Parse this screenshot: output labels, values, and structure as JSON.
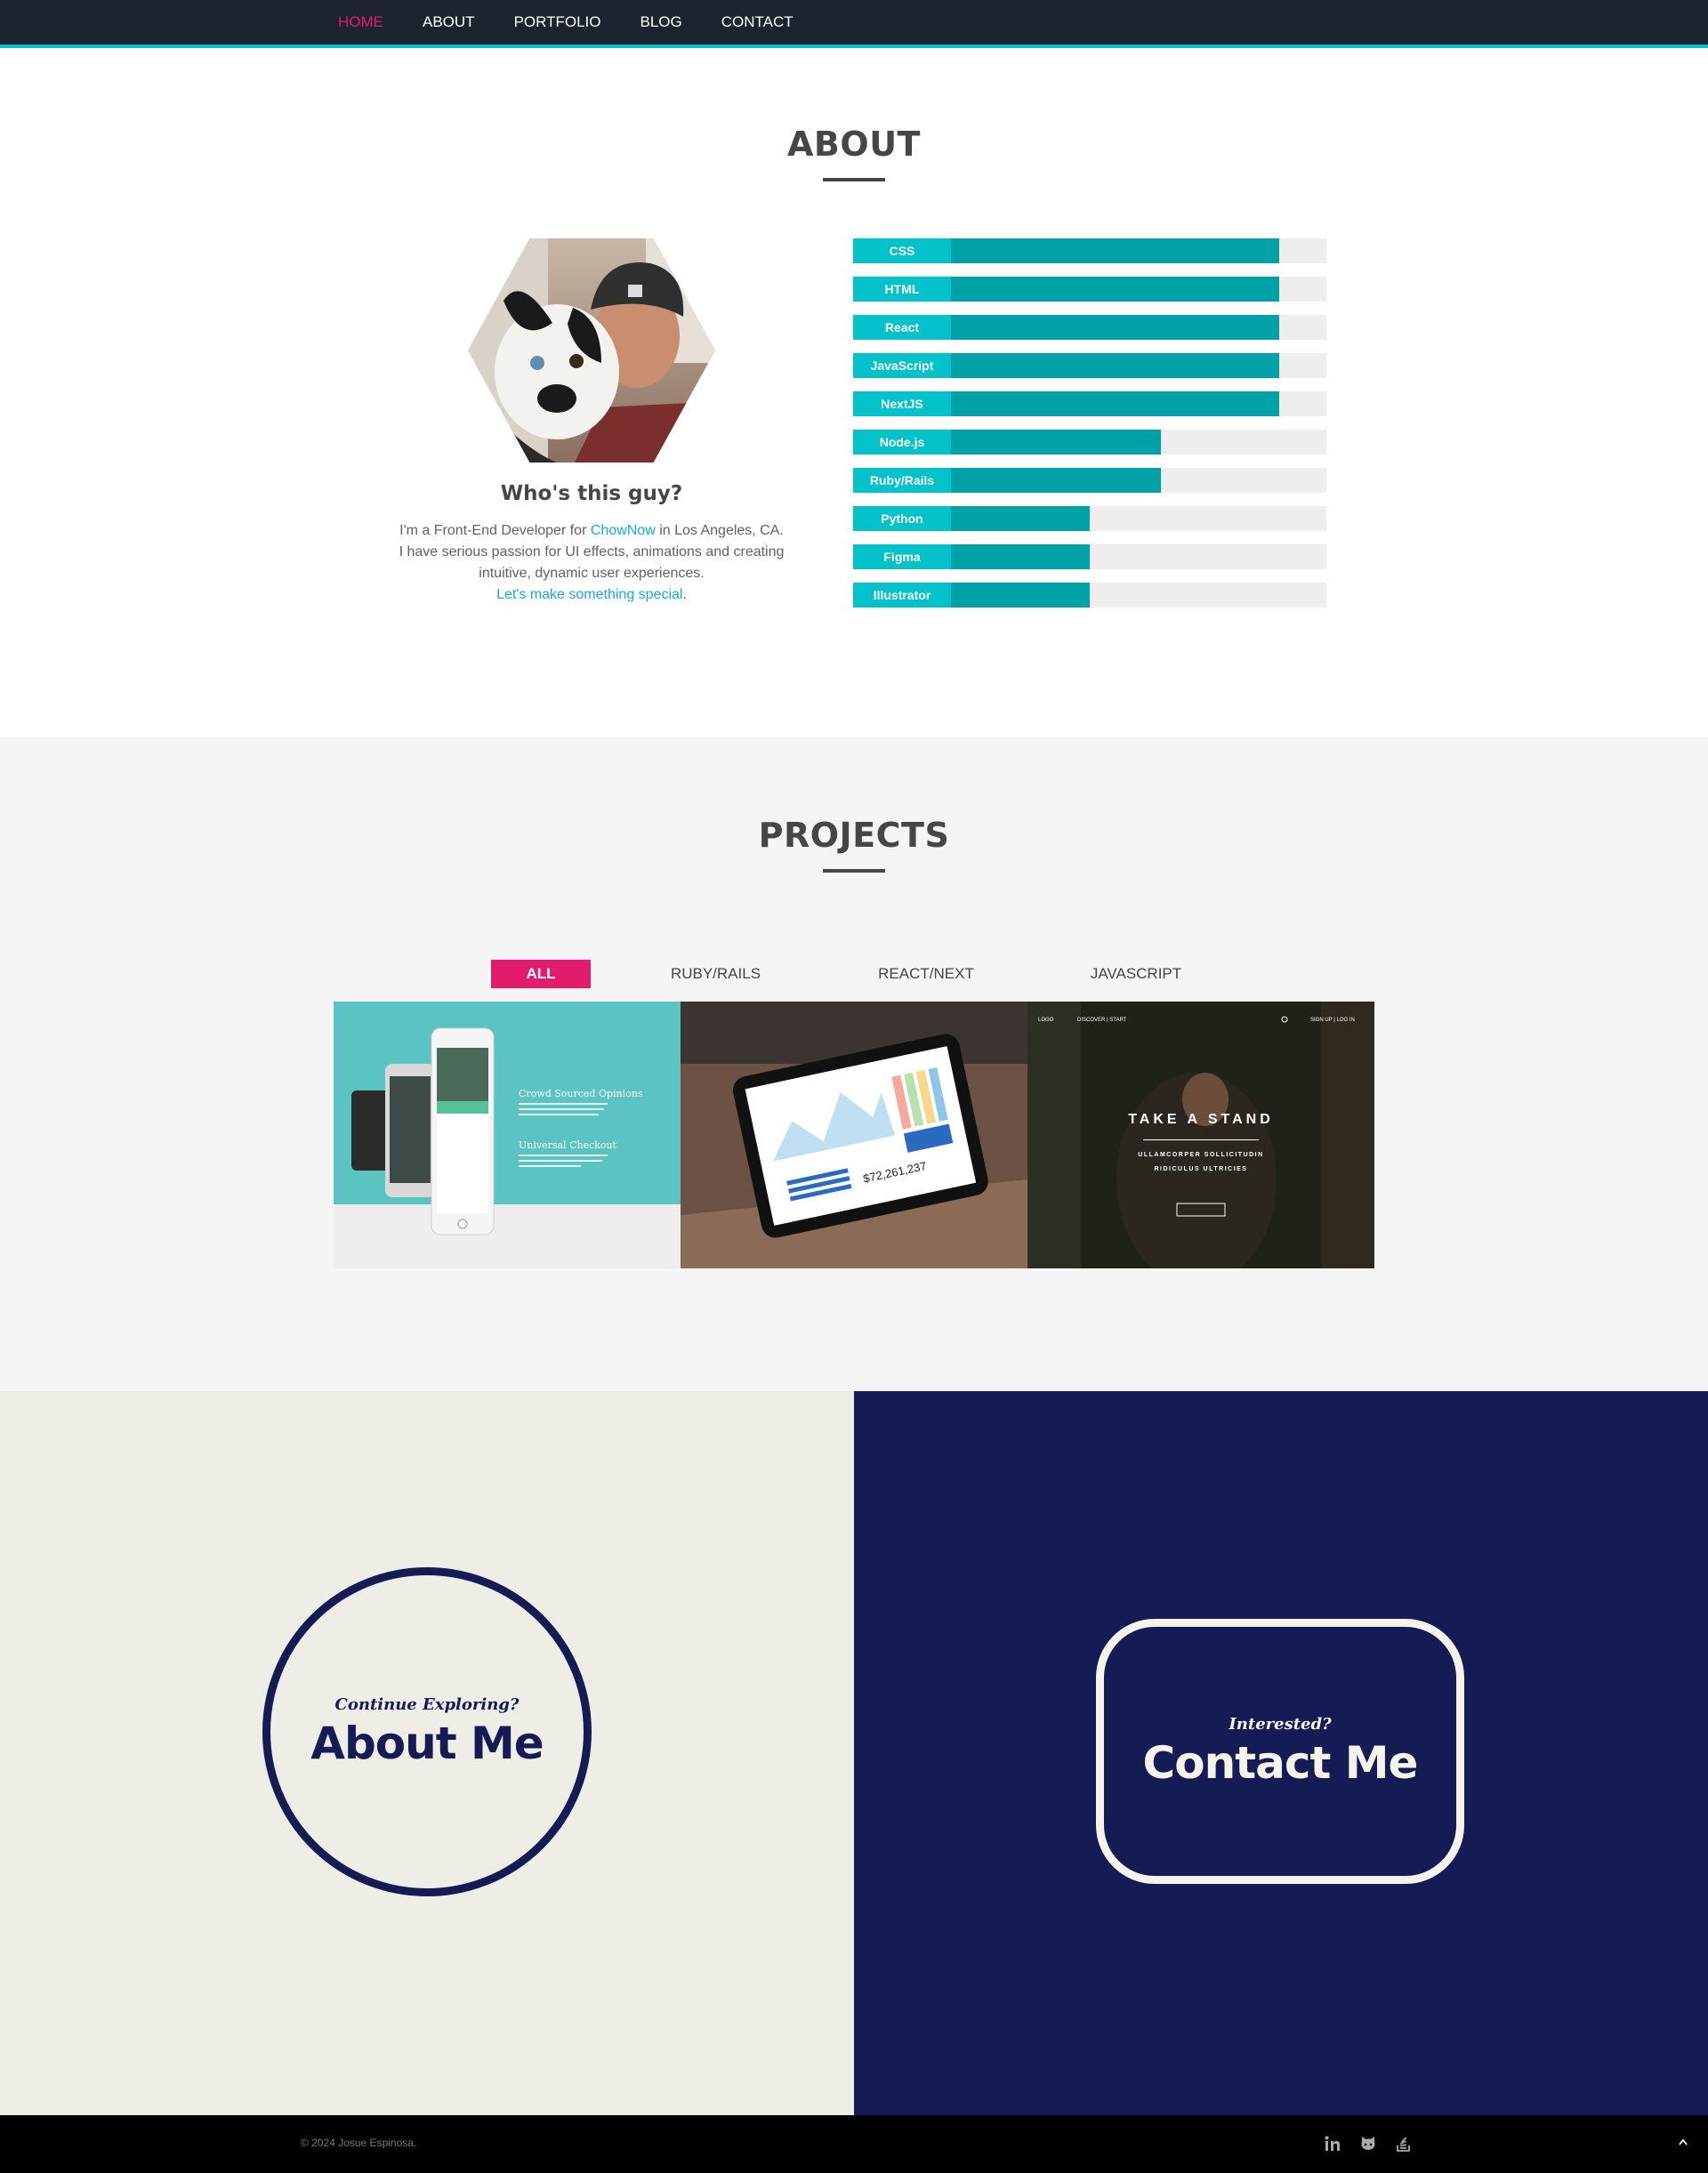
{
  "nav": {
    "items": [
      "HOME",
      "ABOUT",
      "PORTFOLIO",
      "BLOG",
      "CONTACT"
    ],
    "active_index": 0
  },
  "about": {
    "title": "ABOUT",
    "who_title": "Who's this guy?",
    "bio": {
      "part1": "I'm a Front-End Developer for ",
      "company_link": "ChowNow",
      "part2": " in Los Angeles, CA.",
      "line2": "I have serious passion for UI effects, animations and creating",
      "line3": "intuitive, dynamic user experiences.",
      "cta_link": "Let's make something special",
      "cta_end": "."
    },
    "skills": [
      {
        "name": "CSS",
        "level": 0.9
      },
      {
        "name": "HTML",
        "level": 0.9
      },
      {
        "name": "React",
        "level": 0.9
      },
      {
        "name": "JavaScript",
        "level": 0.9
      },
      {
        "name": "NextJS",
        "level": 0.9
      },
      {
        "name": "Node.js",
        "level": 0.65
      },
      {
        "name": "Ruby/Rails",
        "level": 0.65
      },
      {
        "name": "Python",
        "level": 0.5
      },
      {
        "name": "Figma",
        "level": 0.5
      },
      {
        "name": "Illustrator",
        "level": 0.5
      }
    ]
  },
  "projects": {
    "title": "PROJECTS",
    "filters": [
      "ALL",
      "RUBY/RAILS",
      "REACT/NEXT",
      "JAVASCRIPT"
    ],
    "active_filter": 0,
    "cards": [
      {
        "heading1": "Crowd Sourced Opinions",
        "heading2": "Universal Checkout"
      },
      {
        "amount": "$72,261,237"
      },
      {
        "nav_left": "LOGO",
        "nav_mid": "DISCOVER | START",
        "nav_right": "SIGN UP | LOG IN",
        "headline": "TAKE A STAND",
        "sub1": "ULLAMCORPER SOLLICITUDIN",
        "sub2": "RIDICULUS ULTRICIES"
      }
    ]
  },
  "cta": {
    "left": {
      "kicker": "Continue Exploring?",
      "main": "About Me"
    },
    "right": {
      "kicker": "Interested?",
      "main": "Contact Me"
    }
  },
  "footer": {
    "copyright": "© 2024 Josue Espinosa.",
    "social_icons": [
      "linkedin-icon",
      "github-icon",
      "stackoverflow-icon"
    ],
    "to_top_icon": "chevron-up-icon"
  },
  "colors": {
    "nav_bg": "#1b242f",
    "accent_pink": "#e31b6d",
    "accent_teal": "#04c2c9",
    "bar_fill": "#00a1a7",
    "navy": "#151b54",
    "cream": "#eeede6"
  }
}
